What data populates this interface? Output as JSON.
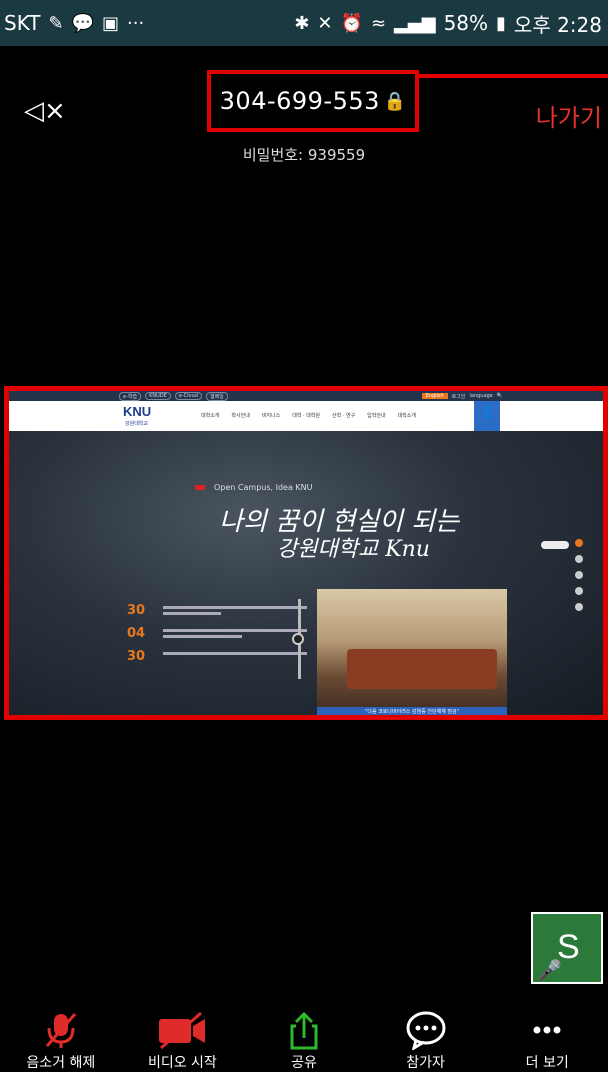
{
  "statusbar": {
    "carrier": "SKT",
    "battery": "58%",
    "time": "오후 2:28"
  },
  "meeting": {
    "id": "304-699-553",
    "password_label": "비밀번호: 939559",
    "leave_label": "나가기"
  },
  "shared_site": {
    "logo": "KNU",
    "logo_sub": "강원대학교",
    "menu": [
      "대학소개",
      "학사안내",
      "비지니스",
      "대학 · 대학원",
      "산학 · 연구",
      "입학안내",
      "대학소개"
    ],
    "tagline": "Open Campus, Idea KNU",
    "headline_1": "나의 꿈이 현실이 되는",
    "headline_2": "강원대학교 Knu",
    "news_dates": [
      "30",
      "04",
      "30"
    ],
    "photo_caption": "\"다음 코로나바이러스 감염증 진단체계 점검\"",
    "top_pills": [
      "e-학습",
      "KNUDE",
      "e-Cloud",
      "웹메일"
    ],
    "top_right": [
      "English",
      "로그인",
      "language"
    ]
  },
  "self_view": {
    "initial": "S"
  },
  "toolbar": {
    "unmute": "음소거 해제",
    "start_video": "비디오 시작",
    "share": "공유",
    "participants": "참가자",
    "more": "더 보기"
  },
  "colors": {
    "accent_red": "#e10000",
    "leave_red": "#e3332a",
    "share_green": "#2eb82e",
    "mute_red": "#e02b2b"
  }
}
